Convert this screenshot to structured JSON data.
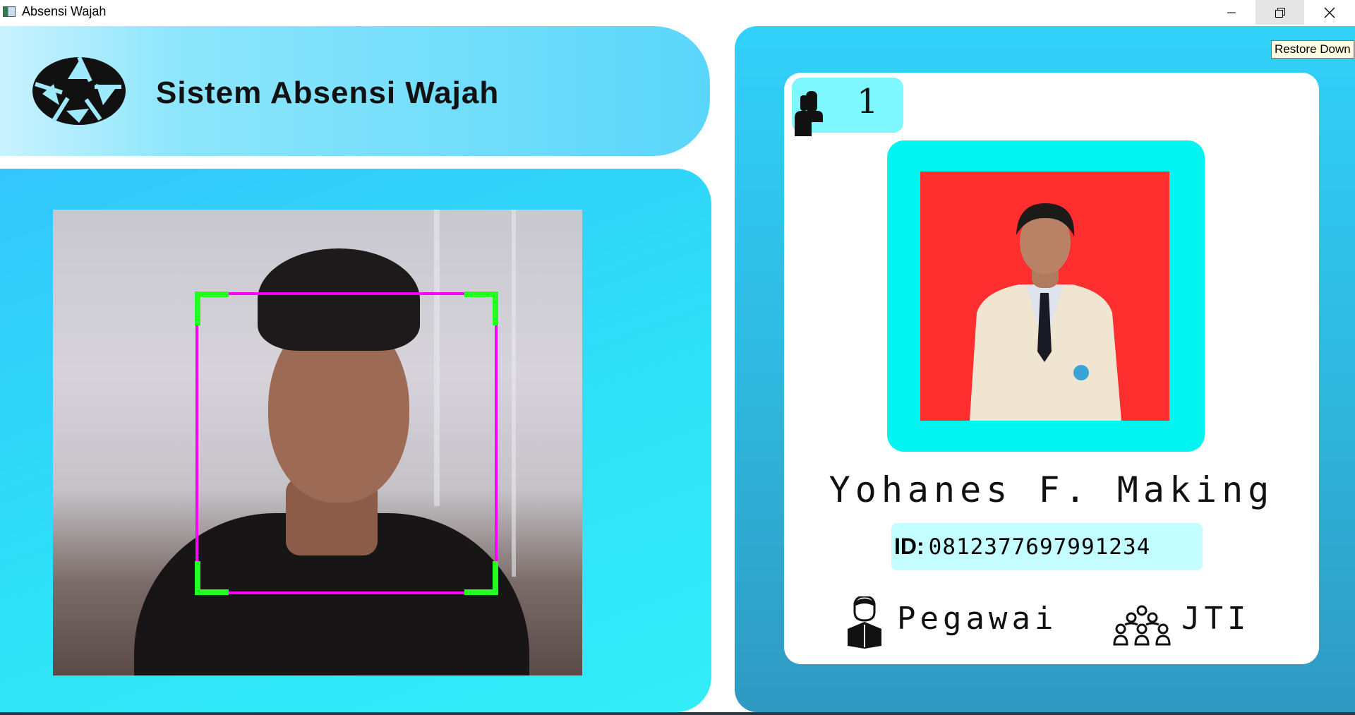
{
  "window": {
    "title": "Absensi Wajah",
    "restore_tooltip": "Restore Down"
  },
  "header": {
    "title": "Sistem Absensi Wajah",
    "logo_icon": "camera-shutter-icon"
  },
  "camera": {
    "face_box_color": "#ff00ff",
    "corner_color": "#22ff22"
  },
  "card": {
    "number": "1",
    "name": "Yohanes F. Making",
    "id_label": "ID:",
    "id_value": "0812377697991234",
    "role": "Pegawai",
    "department": "JTI",
    "photo_background": "#ff2f2f",
    "frame_color": "#00f5f0"
  },
  "colors": {
    "panel_cyan": "#31d1fa",
    "card_white": "#ffffff",
    "badge": "#7ef7ff",
    "id_box": "#c4fdff"
  }
}
